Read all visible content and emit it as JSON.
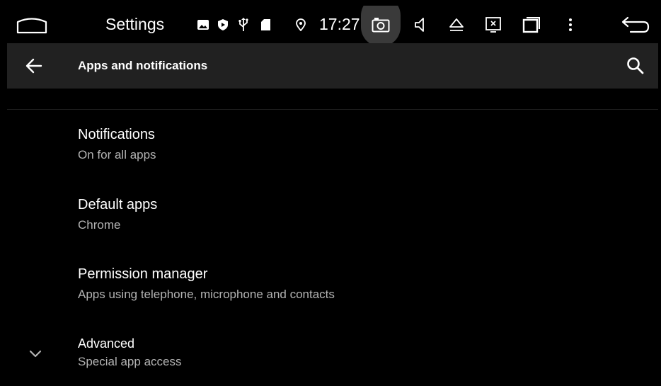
{
  "status_bar": {
    "app_name": "Settings",
    "time": "17:27",
    "icons": [
      "home-icon",
      "image-notification-icon",
      "shield-notification-icon",
      "usb-icon",
      "sd-card-icon",
      "location-icon",
      "camera-icon",
      "volume-icon",
      "eject-icon",
      "screen-close-icon",
      "recent-apps-icon",
      "more-vert-icon",
      "back-icon"
    ]
  },
  "app_bar": {
    "title": "Apps and notifications",
    "back_icon": "arrow-back-icon",
    "search_icon": "search-icon"
  },
  "list": {
    "items": [
      {
        "title": "Notifications",
        "subtitle": "On for all apps"
      },
      {
        "title": "Default apps",
        "subtitle": "Chrome"
      },
      {
        "title": "Permission manager",
        "subtitle": "Apps using telephone, microphone and contacts"
      },
      {
        "title": "Advanced",
        "subtitle": "Special app access",
        "icon": "chevron-down-icon"
      }
    ]
  },
  "colors": {
    "background": "#000000",
    "app_bar": "#212121",
    "primary_text": "#ffffff",
    "secondary_text": "#b3b3b3",
    "camera_highlight": "#3a3a3a"
  }
}
